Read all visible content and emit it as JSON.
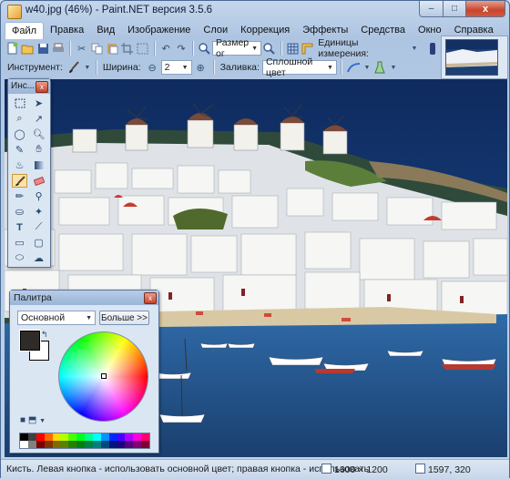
{
  "window": {
    "title": "w40.jpg (46%) - Paint.NET версия 3.5.6",
    "controls": {
      "minimize": "–",
      "maximize": "□",
      "close": "x"
    }
  },
  "menu": [
    "Файл",
    "Правка",
    "Вид",
    "Изображение",
    "Слои",
    "Коррекция",
    "Эффекты",
    "Средства",
    "Окно",
    "Справка"
  ],
  "toolbar1": {
    "size_combo": "Размер ог",
    "units_label": "Единицы измерения:"
  },
  "toolbar2": {
    "tool_label": "Инструмент:",
    "width_label": "Ширина:",
    "width_value": "2",
    "fill_label": "Заливка:",
    "fill_value": "Сплошной цвет"
  },
  "tools_window": {
    "title": "Инс..."
  },
  "palette_window": {
    "title": "Палитра",
    "mode": "Основной",
    "more_button": "Больше >>",
    "primary_color": "#2f2b28",
    "secondary_color": "#ffffff"
  },
  "status": {
    "hint": "Кисть. Левая кнопка - использовать основной цвет; правая кнопка - использовать",
    "image_size": "1600 × 1200",
    "cursor_pos": "1597, 320"
  },
  "colors": {
    "sea": "#1d4a8c",
    "accent": "#c8452d"
  },
  "palette_strip": [
    "#000000",
    "#404040",
    "#ff0000",
    "#ff6a00",
    "#ffd800",
    "#b6ff00",
    "#4cff00",
    "#00ff21",
    "#00ff90",
    "#00ffff",
    "#0094ff",
    "#0026ff",
    "#4800ff",
    "#b200ff",
    "#ff00dc",
    "#ff006e",
    "#ffffff",
    "#808080",
    "#7f0000",
    "#7f3300",
    "#7f6a00",
    "#5b7f00",
    "#267f00",
    "#007f0e",
    "#007f46",
    "#007f7f",
    "#004a7f",
    "#00137f",
    "#21007f",
    "#57007f",
    "#7f006e",
    "#7f0037"
  ]
}
